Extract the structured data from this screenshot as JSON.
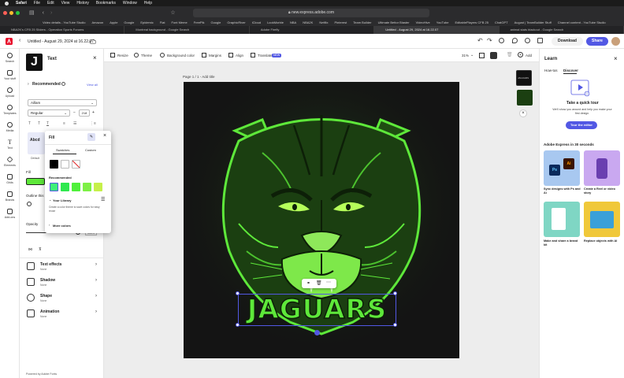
{
  "menubar": {
    "items": [
      "Safari",
      "File",
      "Edit",
      "View",
      "History",
      "Bookmarks",
      "Window",
      "Help"
    ]
  },
  "browser": {
    "url": "new.express.adobe.com",
    "favorites": [
      "Video details - YouTube Studio",
      "Amazon",
      "Apple",
      "Google",
      "Epidemic",
      "Flat",
      "Font Meme",
      "FreePik",
      "Google",
      "GraphicRiver",
      "iCloud",
      "LookMorble",
      "NBA",
      "NBA2K",
      "Netflix",
      "Pinterest",
      "Team Builder",
      "Ultimate Bettor Blaster",
      "VideoHive",
      "YouTube",
      "EditablePlayers CFB 25",
      "ChatGPT",
      "August | TeamBuilder Stuff",
      "Channel content - YouTube Studio"
    ],
    "tabs": [
      {
        "label": "NBA2K's CFB 25 Sliders - Operation Sports Forums",
        "active": false
      },
      {
        "label": "Montreal background - Google Search",
        "active": false
      },
      {
        "label": "Adobe Firefly",
        "active": false
      },
      {
        "label": "Untitled - August 29, 2024 at 16.22.07",
        "active": true
      },
      {
        "label": "animal stats blackout - Google Search",
        "active": false
      }
    ]
  },
  "header": {
    "doc_title": "Untitled - August 29, 2024 at 16.22.07",
    "download": "Download",
    "share": "Share"
  },
  "rail": {
    "items": [
      "Search",
      "Your stuff",
      "Upload",
      "Templates",
      "Media",
      "Text",
      "Elements",
      "Grids",
      "Brands",
      "Add-ons"
    ]
  },
  "text_panel": {
    "title": "Text",
    "recommended": "Recommended",
    "view_all": "View all",
    "font": "Aillam",
    "weight": "Regular",
    "size": "218",
    "style_preview": "Abcd",
    "style_default": "Default",
    "fill_label": "Fill",
    "outline_label": "Outline this",
    "opacity_label": "Opacity",
    "opacity_value": "100%",
    "effects": [
      {
        "title": "Text effects",
        "sub": "None"
      },
      {
        "title": "Shadow",
        "sub": "None"
      },
      {
        "title": "Shape",
        "sub": "None"
      },
      {
        "title": "Animation",
        "sub": "None"
      }
    ],
    "footer": "Powered by Adobe Fonts"
  },
  "fill_popover": {
    "title": "Fill",
    "tab_swatches": "Swatches",
    "tab_custom": "Custom",
    "recommended": "Recommended",
    "your_library": "Your Library",
    "library_hint": "Create a color theme to save colors for easy reuse",
    "more_colors": "More colors",
    "basic_swatches": [
      "#000000",
      "#ffffff"
    ],
    "recommended_swatches": [
      "#3ef07a",
      "#2ee84e",
      "#4ff03a",
      "#7df045",
      "#c6f04a"
    ]
  },
  "canvas_toolbar": {
    "resize": "Resize",
    "theme": "Theme",
    "background_color": "Background color",
    "margins": "Margins",
    "align": "Align",
    "translate": "Translate",
    "new_badge": "NEW",
    "zoom": "31%",
    "add": "Add"
  },
  "canvas": {
    "page_label": "Page 1 / 1 - Add title",
    "headline": "JAGUARS",
    "colors": {
      "accent": "#5ee83a",
      "bg": "#141414"
    }
  },
  "learn": {
    "title": "Learn",
    "tab_howto": "How-tos",
    "tab_discover": "Discover",
    "tour_title": "Take a quick tour",
    "tour_desc": "We'll show you around and help you make your first design.",
    "tour_button": "Tour the editor",
    "section": "Adobe Express in 30 seconds",
    "cards": [
      {
        "title": "Sync designs with Ps and Ai"
      },
      {
        "title": "Create a Reel or video story"
      },
      {
        "title": "Make and share a brand kit"
      },
      {
        "title": "Replace objects with AI"
      }
    ]
  }
}
